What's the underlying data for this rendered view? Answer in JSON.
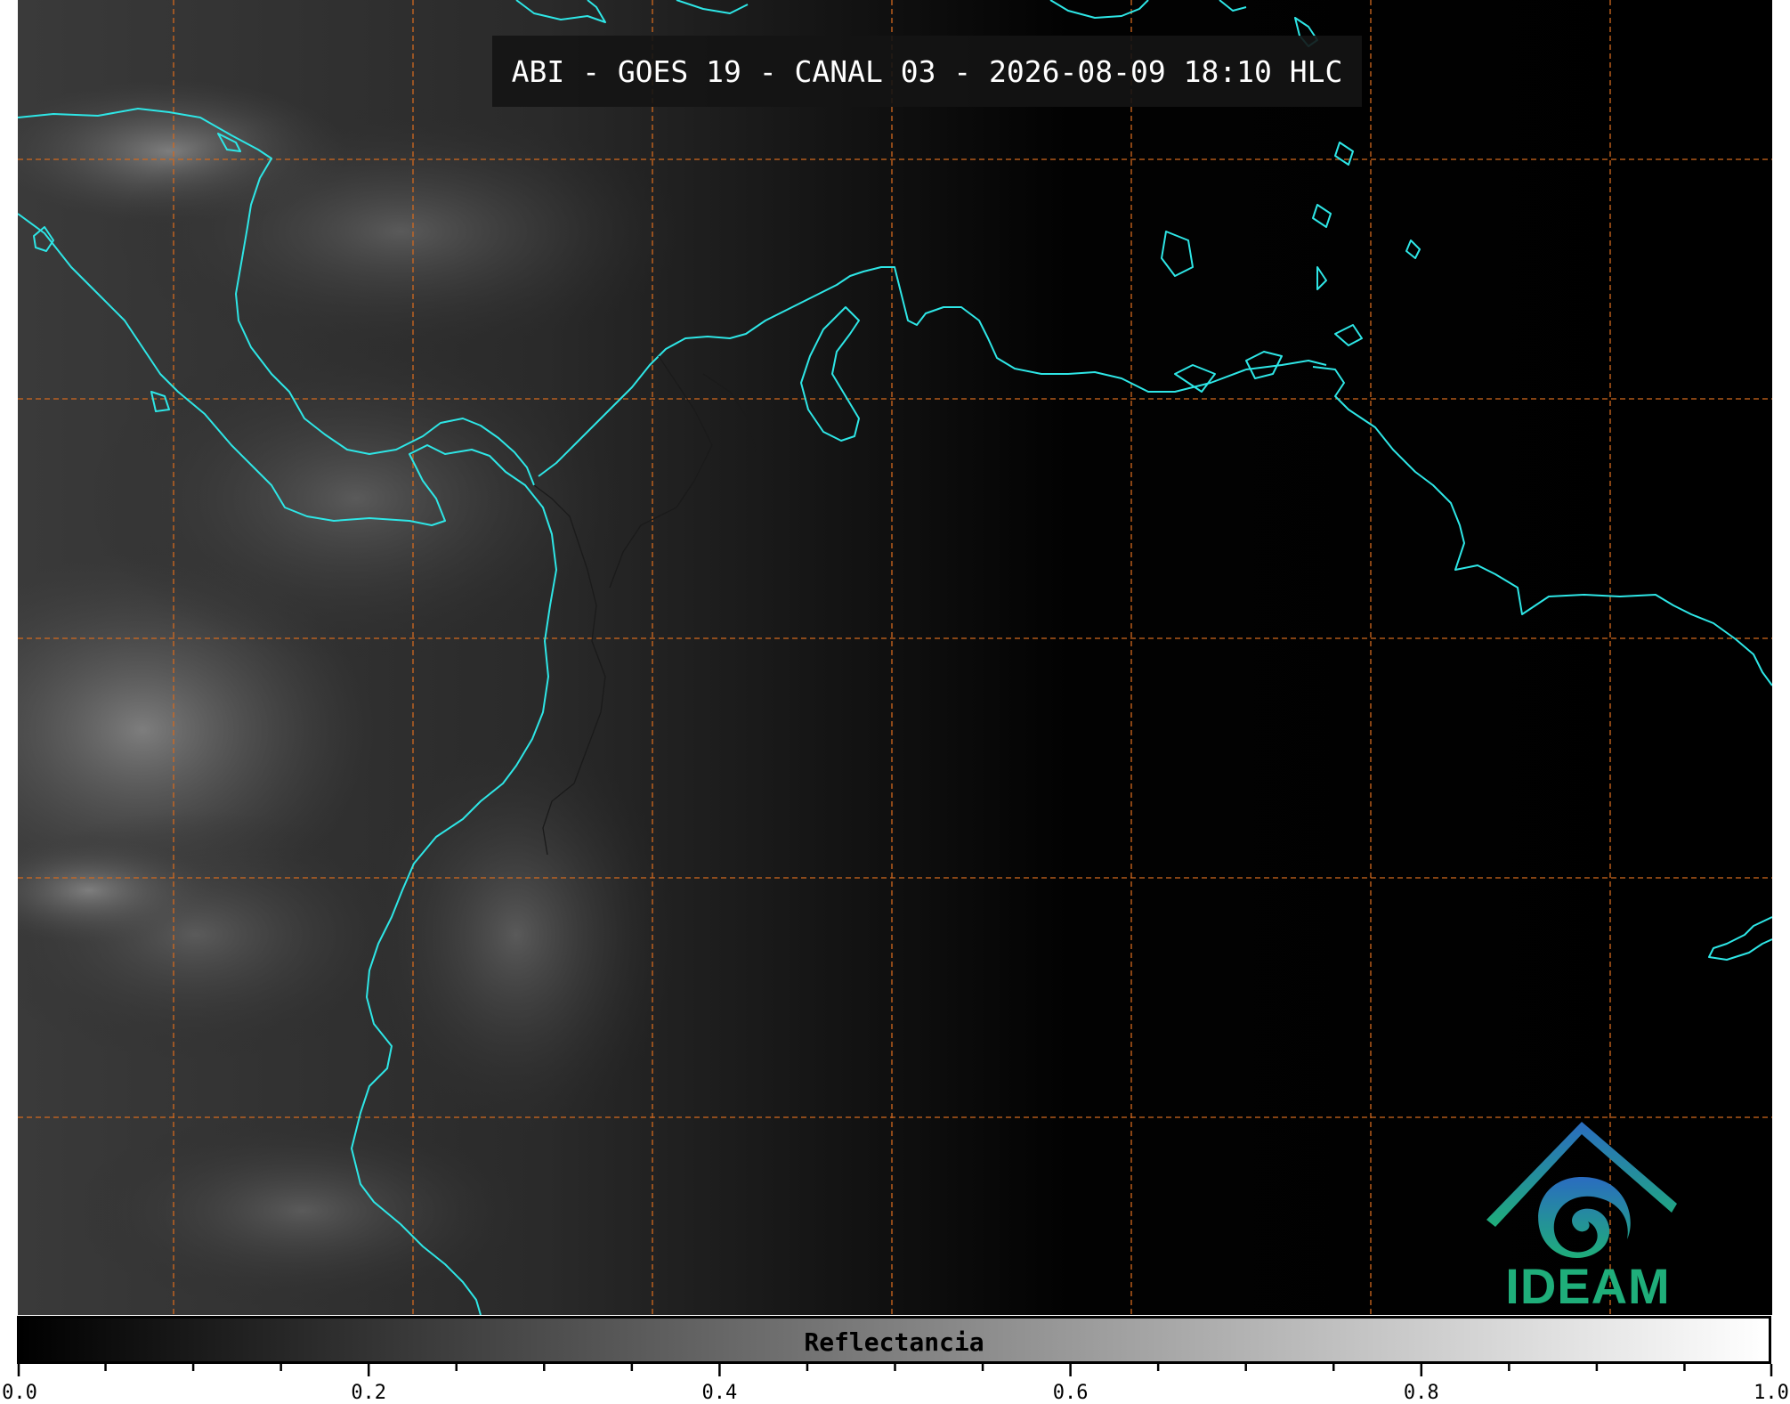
{
  "title": "ABI - GOES 19 - CANAL 03 - 2026-08-09 18:10 HLC",
  "logo": {
    "text": "IDEAM",
    "icon": "ideam-logo-icon"
  },
  "colorbar": {
    "label": "Reflectancia",
    "min": 0.0,
    "max": 1.0,
    "ticks": [
      "0.0",
      "0.2",
      "0.4",
      "0.6",
      "0.8",
      "1.0"
    ],
    "tick_values": [
      0.0,
      0.2,
      0.4,
      0.6,
      0.8,
      1.0
    ],
    "minor_tick_step": 0.05
  },
  "colors": {
    "coastline": "#2ee6e6",
    "gridlines": "#d2691e",
    "background": "#000000",
    "logo_blue": "#2a7ab8",
    "logo_green": "#1fae7a"
  }
}
